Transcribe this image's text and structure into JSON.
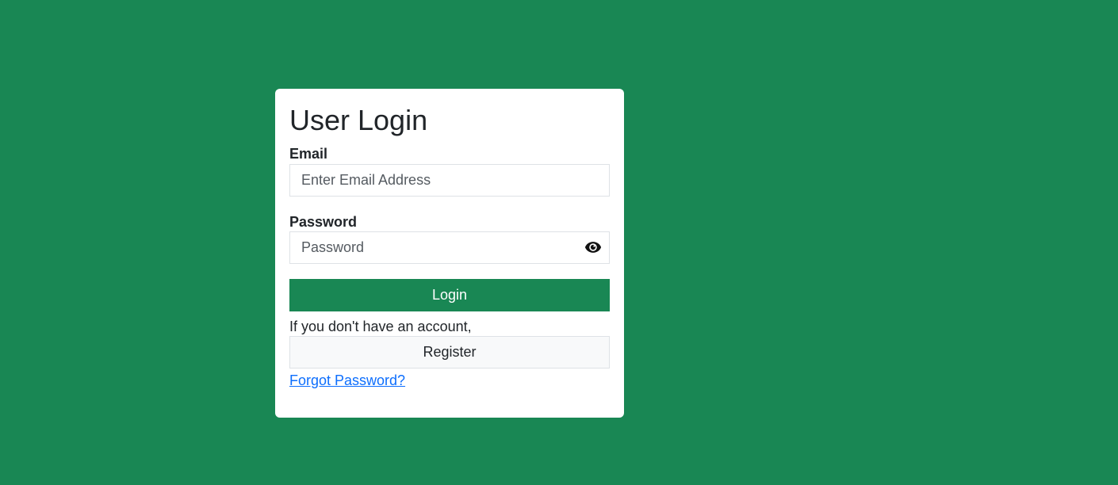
{
  "login_form": {
    "title": "User Login",
    "email": {
      "label": "Email",
      "placeholder": "Enter Email Address",
      "value": ""
    },
    "password": {
      "label": "Password",
      "placeholder": "Password",
      "value": "",
      "toggle_icon": "eye-icon"
    },
    "login_label": "Login",
    "register_prompt": "If you don't have an account,",
    "register_label": "Register",
    "forgot_label": "Forgot Password?"
  },
  "colors": {
    "page_background": "#198754",
    "primary_button": "#198754",
    "link": "#0d6efd",
    "secondary_button": "#f8f9fa"
  }
}
